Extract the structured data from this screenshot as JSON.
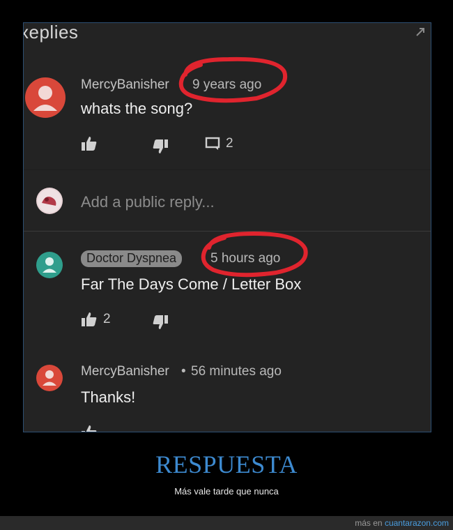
{
  "screenshot": {
    "heading": "Replies",
    "heading_visible": "xeplies",
    "comments": [
      {
        "author": "MercyBanisher",
        "time": "9 years ago",
        "text": "whats the song?",
        "avatar_color": "#d9483a",
        "reply_count": "2",
        "time_circled": true
      },
      {
        "author": "Doctor Dyspnea",
        "time": "5 hours ago",
        "text": "Far The Days Come / Letter Box",
        "avatar_color": "#2f9e8c",
        "like_count": "2",
        "time_circled": true,
        "author_is_creator_chip": true
      },
      {
        "author": "MercyBanisher",
        "separator": "•",
        "time": "56 minutes ago",
        "text": "Thanks!",
        "avatar_color": "#d9483a"
      }
    ],
    "reply_placeholder": "Add a public reply...",
    "icons": [
      "expand-icon",
      "thumb-up-icon",
      "thumb-down-icon",
      "reply-icon"
    ],
    "annotation_color": "#e0242e"
  },
  "caption": {
    "title": "RESPUESTA",
    "subtitle": "Más vale tarde que nunca",
    "title_color": "#3d8ad0"
  },
  "footer": {
    "prefix": "más en ",
    "site": "cuantarazon.com"
  }
}
